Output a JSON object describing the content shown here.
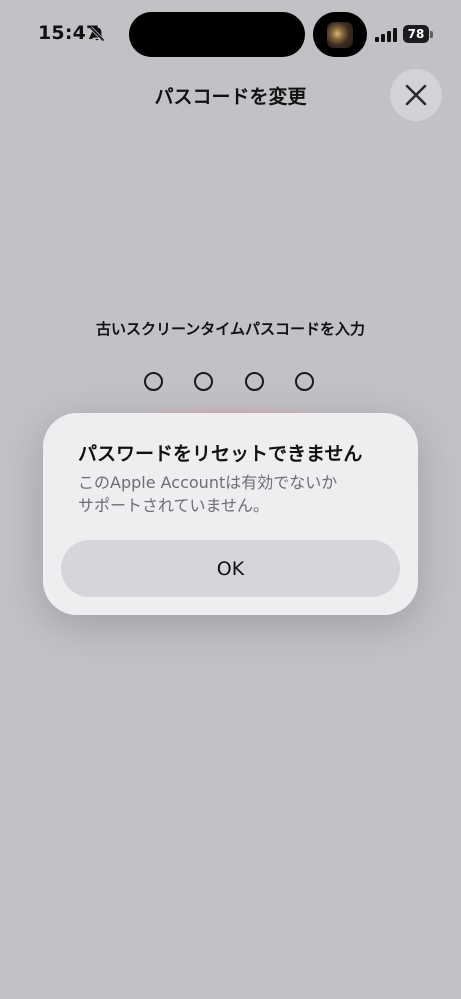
{
  "status_bar": {
    "time": "15:47",
    "battery": "78",
    "icons": [
      "bell-slash-icon",
      "signal-icon",
      "battery-icon"
    ]
  },
  "nav": {
    "title": "パスコードを変更",
    "close_icon": "close-icon"
  },
  "passcode": {
    "prompt": "古いスクリーンタイムパスコードを入力",
    "digit_count": 4,
    "entered": 0
  },
  "alert": {
    "title": "パスワードをリセットできません",
    "message_line1": "このApple Accountは有効でないか",
    "message_line2": "サポートされていません。",
    "ok_label": "OK"
  },
  "colors": {
    "background": "#c2c1c6",
    "alert_background": "#efeef1",
    "button_background": "#d6d5d9"
  }
}
